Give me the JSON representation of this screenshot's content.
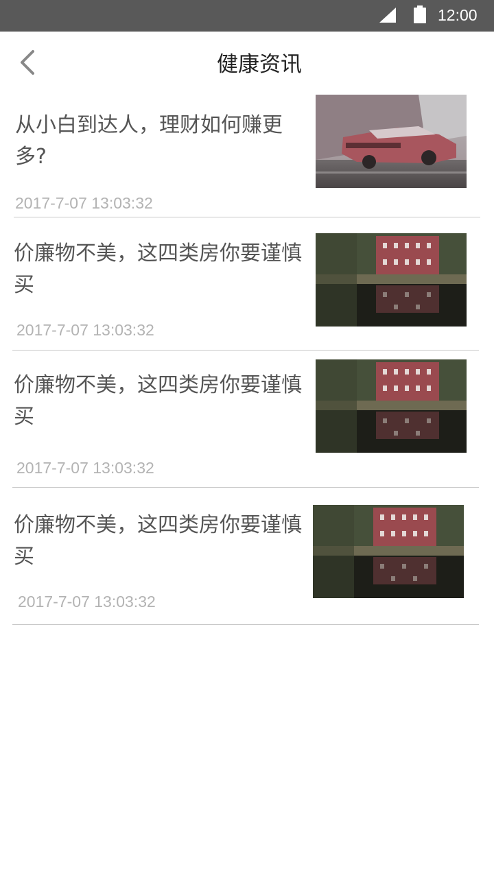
{
  "status_bar": {
    "time": "12:00",
    "signal_icon": "signal-icon",
    "battery_icon": "battery-icon"
  },
  "app_bar": {
    "title": "健康资讯",
    "back_icon": "chevron-left-icon"
  },
  "news": [
    {
      "title": "从小白到达人，理财如何赚更多?",
      "time": "2017-7-07 13:03:32",
      "thumbnail": "red-car-photo"
    },
    {
      "title": "价廉物不美，这四类房你要谨慎买",
      "time": "2017-7-07 13:03:32",
      "thumbnail": "red-house-lake-photo"
    },
    {
      "title": "价廉物不美，这四类房你要谨慎买",
      "time": "2017-7-07 13:03:32",
      "thumbnail": "red-house-lake-photo"
    },
    {
      "title": "价廉物不美，这四类房你要谨慎买",
      "time": "2017-7-07 13:03:32",
      "thumbnail": "red-house-lake-photo"
    }
  ]
}
